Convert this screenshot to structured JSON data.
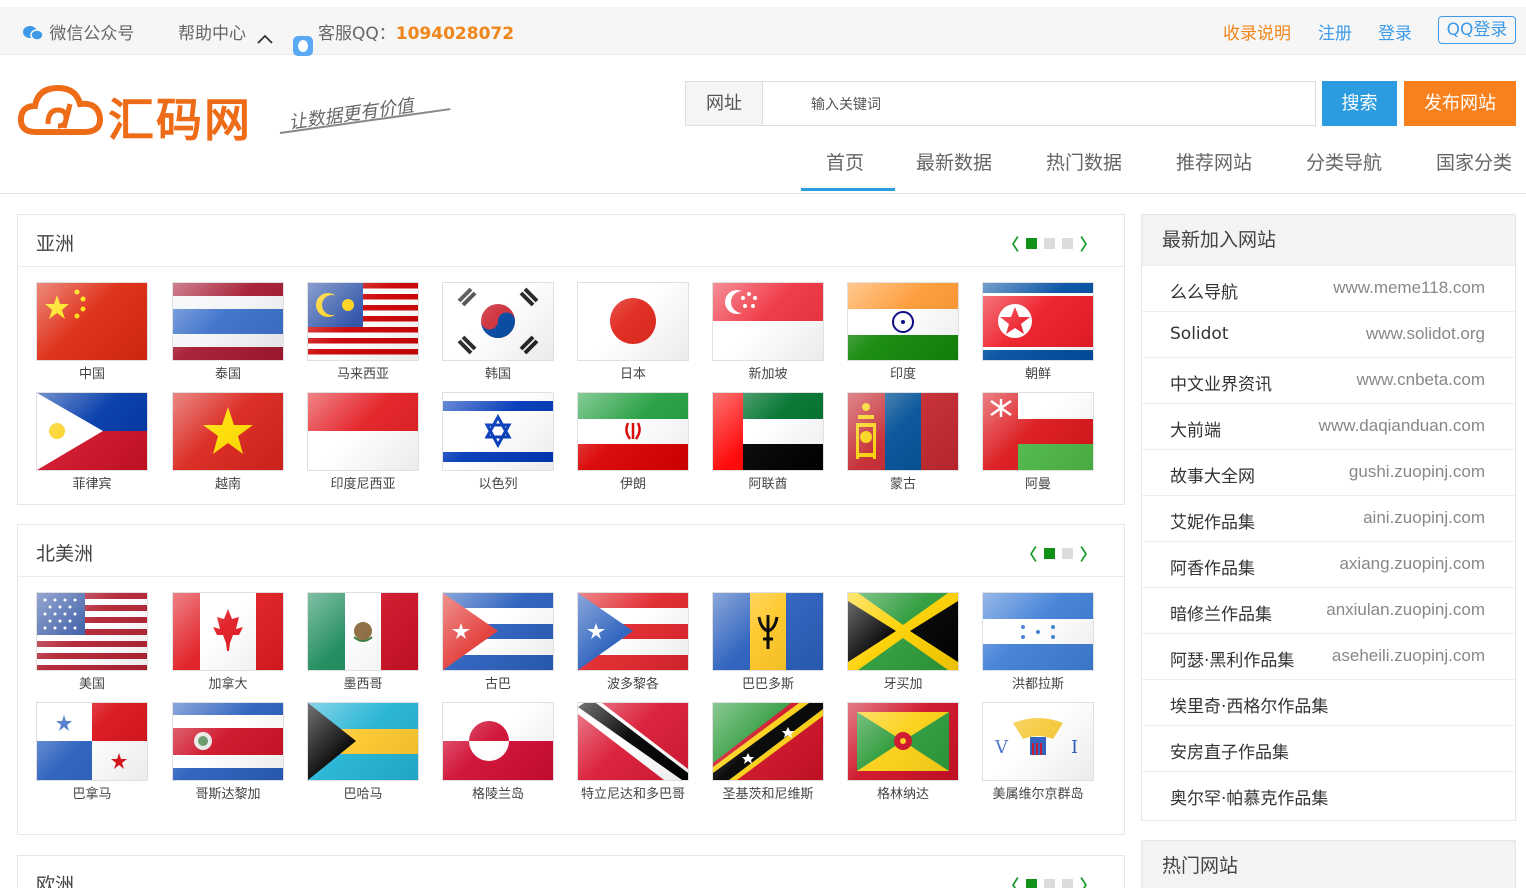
{
  "topbar": {
    "wechat": "微信公众号",
    "help": "帮助中心",
    "qq_label": "客服QQ：",
    "qq_number": "1094028072",
    "inclusion": "收录说明",
    "register": "注册",
    "login": "登录",
    "qq_login": "QQ登录"
  },
  "header": {
    "logo_text": "汇码网",
    "slogan": "让数据更有价值",
    "search_label": "网址",
    "search_placeholder": "输入关键词",
    "search_button": "搜索",
    "publish_button": "发布网站"
  },
  "nav": [
    "首页",
    "最新数据",
    "热门数据",
    "推荐网站",
    "分类导航",
    "国家分类"
  ],
  "colors": {
    "accent_blue": "#2d9bdf",
    "accent_orange": "#f8811d",
    "pager_green": "#129118"
  },
  "continents": {
    "asia": {
      "title": "亚洲",
      "pages": 3,
      "current_page": 1,
      "countries": [
        "中国",
        "泰国",
        "马来西亚",
        "韩国",
        "日本",
        "新加坡",
        "印度",
        "朝鲜",
        "菲律宾",
        "越南",
        "印度尼西亚",
        "以色列",
        "伊朗",
        "阿联酋",
        "蒙古",
        "阿曼"
      ]
    },
    "north_america": {
      "title": "北美洲",
      "pages": 2,
      "current_page": 1,
      "countries": [
        "美国",
        "加拿大",
        "墨西哥",
        "古巴",
        "波多黎各",
        "巴巴多斯",
        "牙买加",
        "洪都拉斯",
        "巴拿马",
        "哥斯达黎加",
        "巴哈马",
        "格陵兰岛",
        "特立尼达和多巴哥",
        "圣基茨和尼维斯",
        "格林纳达",
        "美属维尔京群岛"
      ]
    },
    "europe": {
      "title": "欧洲",
      "pages": 3,
      "current_page": 1
    }
  },
  "sidebar": {
    "latest_title": "最新加入网站",
    "latest": [
      {
        "name": "么么导航",
        "url": "www.meme118.com"
      },
      {
        "name": "Solidot",
        "url": "www.solidot.org"
      },
      {
        "name": "中文业界资讯",
        "url": "www.cnbeta.com"
      },
      {
        "name": "大前端",
        "url": "www.daqianduan.com"
      },
      {
        "name": "故事大全网",
        "url": "gushi.zuopinj.com"
      },
      {
        "name": "艾妮作品集",
        "url": "aini.zuopinj.com"
      },
      {
        "name": "阿香作品集",
        "url": "axiang.zuopinj.com"
      },
      {
        "name": "暗修兰作品集",
        "url": "anxiulan.zuopinj.com"
      },
      {
        "name": "阿瑟·黑利作品集",
        "url": "aseheili.zuopinj.com"
      },
      {
        "name": "埃里奇·西格尔作品集",
        "url": ""
      },
      {
        "name": "安房直子作品集",
        "url": ""
      },
      {
        "name": "奥尔罕·帕慕克作品集",
        "url": ""
      }
    ],
    "hot_title": "热门网站"
  }
}
